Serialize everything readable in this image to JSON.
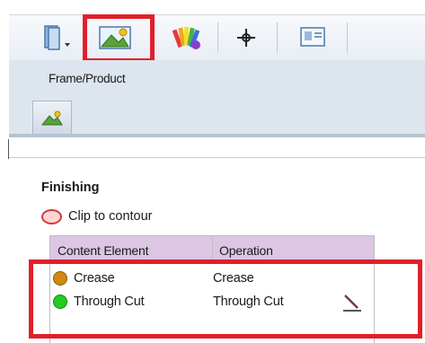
{
  "toolbar": {
    "buttons": [
      {
        "icon": "book-dropdown-icon"
      },
      {
        "icon": "frame-product-icon",
        "active": true
      },
      {
        "icon": "color-palette-icon"
      },
      {
        "icon": "crosshair-icon"
      },
      {
        "icon": "id-card-icon"
      }
    ]
  },
  "frame_panel": {
    "label": "Frame/Product",
    "tab_icon": "frame-product-icon"
  },
  "finishing": {
    "title": "Finishing",
    "clip_label": "Clip to contour",
    "table": {
      "headers": {
        "content": "Content Element",
        "operation": "Operation"
      },
      "rows": [
        {
          "content": "Crease",
          "operation": "Crease",
          "color": "#d08a10"
        },
        {
          "content": "Through Cut",
          "operation": "Through Cut",
          "color": "#22cc22"
        }
      ]
    }
  },
  "colors": {
    "highlight": "#e0202a",
    "header_bg": "#dcc6e4"
  }
}
